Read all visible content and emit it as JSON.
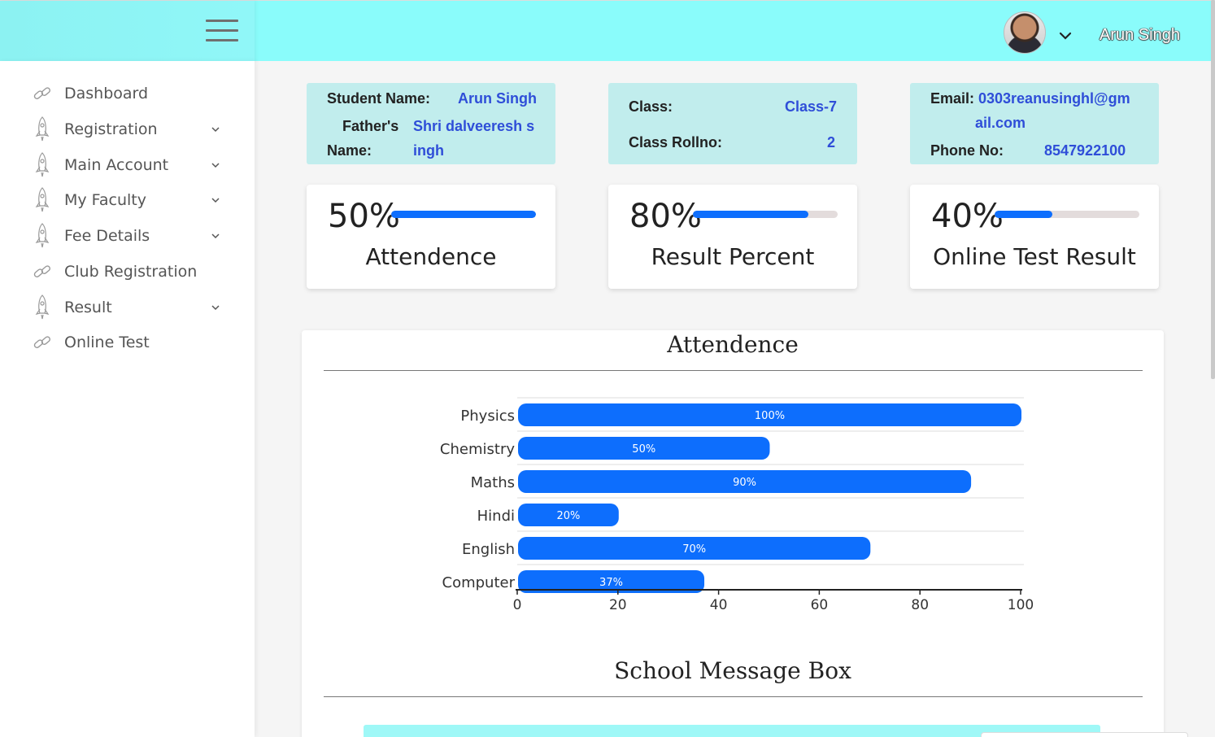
{
  "header": {
    "user_name": "Arun Singh",
    "icons": [
      "hamburger-menu-icon",
      "avatar",
      "chevron-down-icon"
    ],
    "colors": {
      "topbar": "#8afcfb",
      "accent": "#0d6efd",
      "info_card": "#c1eded",
      "info_value": "#2f4ed8"
    }
  },
  "sidebar": {
    "items": [
      {
        "label": "Dashboard",
        "icon": "link-icon",
        "has_children": false
      },
      {
        "label": "Registration",
        "icon": "rocket-icon",
        "has_children": true
      },
      {
        "label": "Main Account",
        "icon": "rocket-icon",
        "has_children": true
      },
      {
        "label": "My Faculty",
        "icon": "rocket-icon",
        "has_children": true
      },
      {
        "label": "Fee Details",
        "icon": "rocket-icon",
        "has_children": true
      },
      {
        "label": "Club Registration",
        "icon": "link-icon",
        "has_children": false
      },
      {
        "label": "Result",
        "icon": "rocket-icon",
        "has_children": true
      },
      {
        "label": "Online Test",
        "icon": "link-icon",
        "has_children": false
      }
    ]
  },
  "info": {
    "student_name_label": "Student Name:",
    "student_name": "Arun Singh",
    "father_label_1": "Father's",
    "father_label_2": "Name:",
    "father_name_1": "Shri dalveeresh s",
    "father_name_2": "ingh",
    "class_label": "Class:",
    "class_value": "Class-7",
    "rollno_label": "Class Rollno:",
    "rollno_value": "2",
    "email_label": "Email:",
    "email_1": "0303reanusinghl@gm",
    "email_2": "ail.com",
    "phone_label": "Phone No:",
    "phone_value": "8547922100"
  },
  "stats": [
    {
      "percent_text": "50%",
      "value": 100,
      "title": "Attendence"
    },
    {
      "percent_text": "80%",
      "value": 80,
      "title": "Result Percent"
    },
    {
      "percent_text": "40%",
      "value": 40,
      "title": "Online Test Result"
    }
  ],
  "panel": {
    "chart_title": "Attendence",
    "message_title": "School Message Box"
  },
  "chart_data": {
    "type": "bar",
    "orientation": "horizontal",
    "categories": [
      "Physics",
      "Chemistry",
      "Maths",
      "Hindi",
      "English",
      "Computer"
    ],
    "values": [
      100,
      50,
      90,
      20,
      70,
      37
    ],
    "data_labels": [
      "100%",
      "50%",
      "90%",
      "20%",
      "70%",
      "37%"
    ],
    "x_ticks": [
      "0",
      "20",
      "40",
      "60",
      "80",
      "100"
    ],
    "xlim": [
      0,
      100
    ],
    "grid": "horizontal",
    "bar_color": "#0d6efd"
  }
}
